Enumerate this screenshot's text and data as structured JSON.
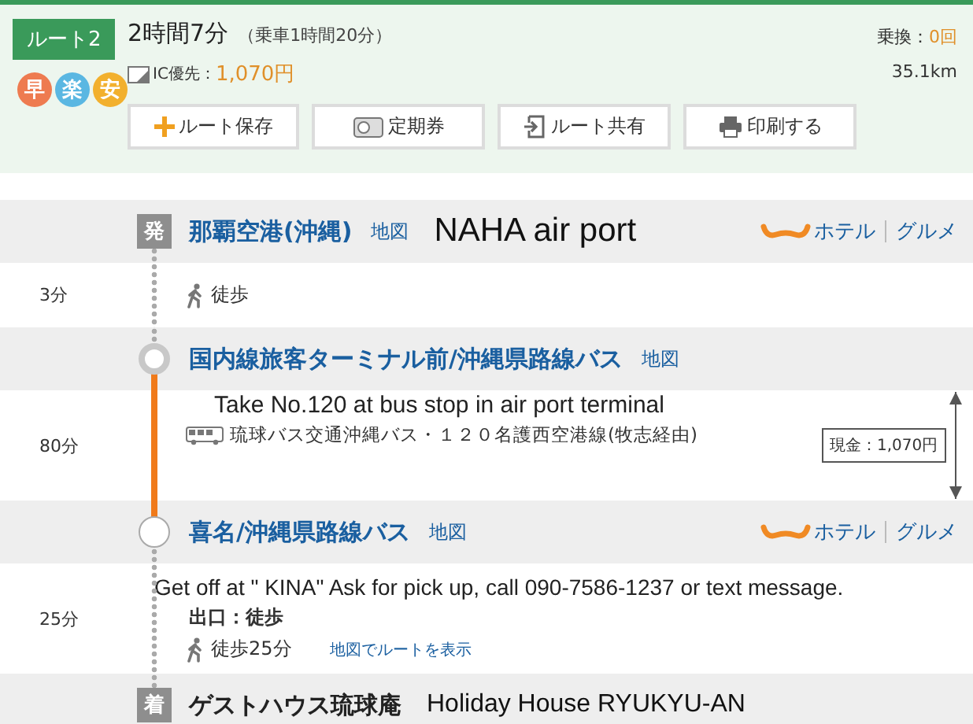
{
  "route": {
    "label": "ルート2",
    "badges": [
      {
        "text": "早",
        "color": "#ee7b50"
      },
      {
        "text": "楽",
        "color": "#5ab7e2"
      },
      {
        "text": "安",
        "color": "#f2b02e"
      }
    ],
    "duration": "2時間7分",
    "ride_time": "（乗車1時間20分）",
    "ic_label": "IC優先：",
    "fare": "1,070円",
    "transfers_label": "乗換：",
    "transfers_value": "0回",
    "distance": "35.1km",
    "buttons": [
      {
        "label": "ルート保存",
        "kind": "plus"
      },
      {
        "label": "定期券",
        "kind": "pass"
      },
      {
        "label": "ルート共有",
        "kind": "share"
      },
      {
        "label": "印刷する",
        "kind": "print"
      }
    ]
  },
  "timeline": [
    {
      "kind": "station",
      "marker": {
        "kind": "label",
        "text": "発"
      },
      "name": "那覇空港(沖縄)",
      "link": true,
      "map": "地図",
      "note": "NAHA air port",
      "hotel": "ホテル",
      "gourmet": "グルメ"
    },
    {
      "kind": "segment",
      "duration": "3分",
      "lines": [
        {
          "kind": "walk",
          "text": "徒歩"
        }
      ]
    },
    {
      "kind": "station",
      "marker": {
        "kind": "ring"
      },
      "name": "国内線旅客ターミナル前/沖縄県路線バス",
      "link": true,
      "map": "地図"
    },
    {
      "kind": "segment",
      "duration": "80分",
      "note": "Take No.120 at bus stop in air port terminal",
      "lines": [
        {
          "kind": "bus",
          "text": "琉球バス交通沖縄バス・１２０名護西空港線(牧志経由)"
        }
      ],
      "fare": "現金：1,070円"
    },
    {
      "kind": "station",
      "marker": {
        "kind": "circle"
      },
      "name": "喜名/沖縄県路線バス",
      "link": true,
      "map": "地図",
      "hotel": "ホテル",
      "gourmet": "グルメ"
    },
    {
      "kind": "segment",
      "duration": "25分",
      "note": "Get off at \" KINA\" Ask for pick up, call 090-7586-1237 or text message.",
      "exit": "出口：徒歩",
      "lines": [
        {
          "kind": "walk",
          "text": "徒歩25分",
          "link": "地図でルートを表示"
        }
      ]
    },
    {
      "kind": "station",
      "marker": {
        "kind": "label",
        "text": "着"
      },
      "name": "ゲストハウス琉球庵",
      "link": false,
      "note": "Holiday House RYUKYU-AN"
    }
  ]
}
